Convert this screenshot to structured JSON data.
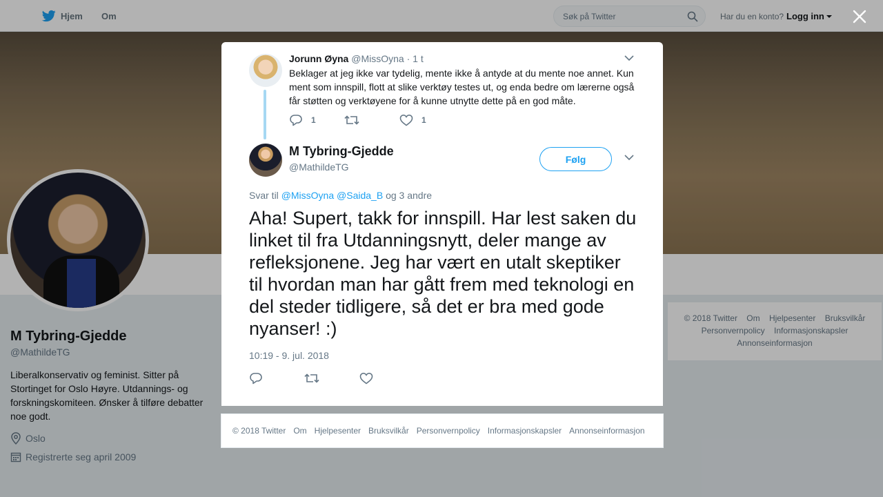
{
  "nav": {
    "home_label": "Hjem",
    "about_label": "Om",
    "search_placeholder": "Søk på Twitter",
    "login_prompt": "Har du en konto?",
    "login_label": "Logg inn",
    "brand_color": "#1da1f2"
  },
  "profile": {
    "name": "M Tybring-Gjedde",
    "handle": "@MathildeTG",
    "bio": "Liberalkonservativ og feminist. Sitter på Stortinget for Oslo Høyre. Utdannings- og forskningskomiteen. Ønsker å tilføre debatter noe godt.",
    "location": "Oslo",
    "joined": "Registrerte seg april 2009"
  },
  "side_footer": {
    "links": [
      "© 2018 Twitter",
      "Om",
      "Hjelpesenter",
      "Bruksvilkår",
      "Personvernpolicy",
      "Informasjonskapsler",
      "Annonseinformasjon"
    ]
  },
  "reply_tweet": {
    "name": "Jorunn Øyna",
    "handle": "@MissOyna",
    "time": "· 1 t",
    "text": "Beklager at jeg ikke var tydelig, mente ikke å antyde at du mente noe annet. Kun ment som innspill, flott at slike verktøy testes ut, og enda bedre om lærerne også får støtten og verktøyene for å kunne utnytte dette på en god måte.",
    "reply_count": "1",
    "like_count": "1"
  },
  "main_tweet": {
    "name": "M Tybring-Gjedde",
    "handle": "@MathildeTG",
    "follow_label": "Følg",
    "reply_prefix": "Svar til",
    "mention_1": "@MissOyna",
    "mention_2": "@Saida_B",
    "reply_suffix": "og 3 andre",
    "text": "Aha! Supert, takk for innspill. Har lest saken du linket til fra Utdanningsnytt, deler mange av refleksjonene. Jeg har vært en utalt skeptiker til hvordan man har gått frem med teknologi en del steder tidligere, så det er bra med gode nyanser! :)",
    "timestamp": "10:19 - 9. jul. 2018"
  },
  "modal_footer": {
    "links": [
      "© 2018 Twitter",
      "Om",
      "Hjelpesenter",
      "Bruksvilkår",
      "Personvernpolicy",
      "Informasjonskapsler",
      "Annonseinformasjon"
    ]
  },
  "icons": {
    "bird": "twitter-bird-icon",
    "search": "search-icon",
    "close": "close-icon",
    "reply": "reply-icon",
    "retweet": "retweet-icon",
    "like": "heart-icon",
    "location": "location-pin-icon",
    "calendar": "calendar-icon",
    "chevron": "chevron-down-icon"
  }
}
